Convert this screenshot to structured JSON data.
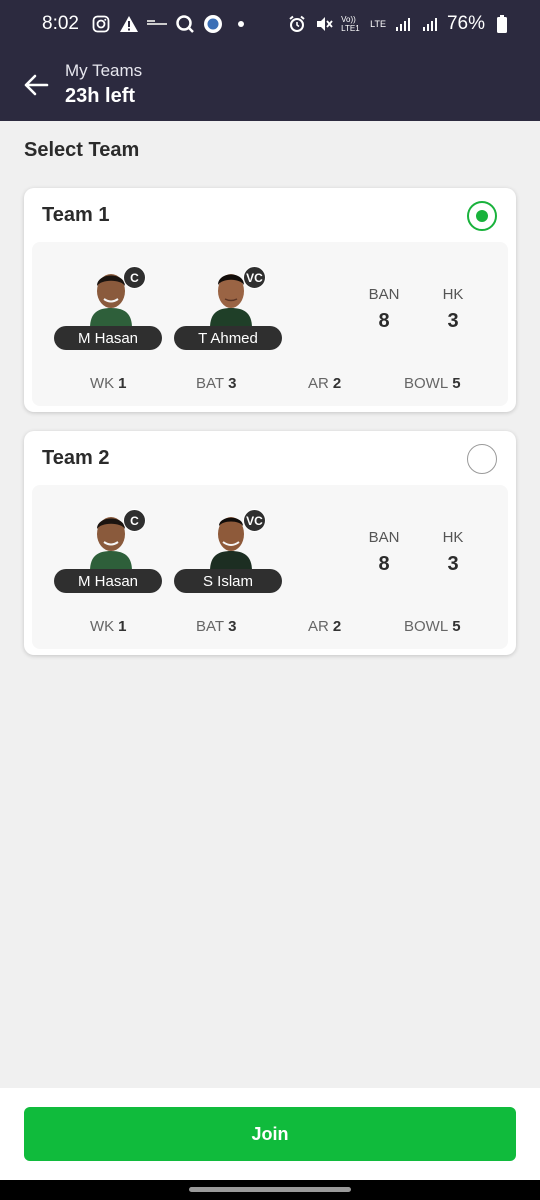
{
  "status_bar": {
    "time": "8:02",
    "battery": "76%",
    "network": "Vo)) LTE1",
    "lte": "LTE",
    "icons_left": [
      "instagram-icon",
      "alert-icon",
      "app-icon",
      "search-app-icon",
      "circle-app-icon",
      "dot-icon"
    ],
    "icons_right": [
      "alarm-icon",
      "mute-icon",
      "signal-icon",
      "signal-icon",
      "battery-icon"
    ]
  },
  "header": {
    "title": "My Teams",
    "subtitle": "23h left"
  },
  "section_title": "Select Team",
  "teams": [
    {
      "name": "Team 1",
      "selected": true,
      "captain": {
        "name": "M Hasan",
        "badge": "C"
      },
      "vice_captain": {
        "name": "T Ahmed",
        "badge": "VC"
      },
      "counts": [
        {
          "label": "BAN",
          "value": "8"
        },
        {
          "label": "HK",
          "value": "3"
        }
      ],
      "roles": [
        {
          "label": "WK",
          "value": "1"
        },
        {
          "label": "BAT",
          "value": "3"
        },
        {
          "label": "AR",
          "value": "2"
        },
        {
          "label": "BOWL",
          "value": "5"
        }
      ]
    },
    {
      "name": "Team 2",
      "selected": false,
      "captain": {
        "name": "M Hasan",
        "badge": "C"
      },
      "vice_captain": {
        "name": "S Islam",
        "badge": "VC"
      },
      "counts": [
        {
          "label": "BAN",
          "value": "8"
        },
        {
          "label": "HK",
          "value": "3"
        }
      ],
      "roles": [
        {
          "label": "WK",
          "value": "1"
        },
        {
          "label": "BAT",
          "value": "3"
        },
        {
          "label": "AR",
          "value": "2"
        },
        {
          "label": "BOWL",
          "value": "5"
        }
      ]
    }
  ],
  "join_button": "Join",
  "colors": {
    "header_bg": "#2c2a3f",
    "accent_green": "#10bb3c",
    "radio_green": "#19b23c"
  }
}
